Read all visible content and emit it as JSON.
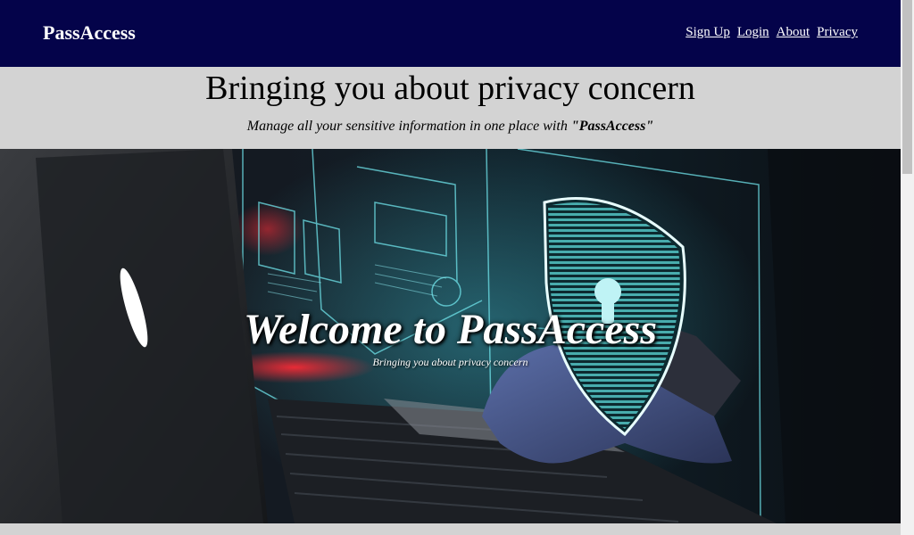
{
  "navbar": {
    "brand": "PassAccess",
    "links": [
      "Sign Up",
      "Login",
      "About",
      "Privacy"
    ],
    "background": "#04034a"
  },
  "intro": {
    "heading": "Bringing you about privacy concern",
    "tagline_prefix": "Manage all your sensitive information in one place with ",
    "tagline_brand": "\"PassAccess\""
  },
  "hero": {
    "title": "Welcome to PassAccess",
    "subtitle": "Bringing you about privacy concern",
    "image": "hacker-laptop-shield-lock-image"
  }
}
